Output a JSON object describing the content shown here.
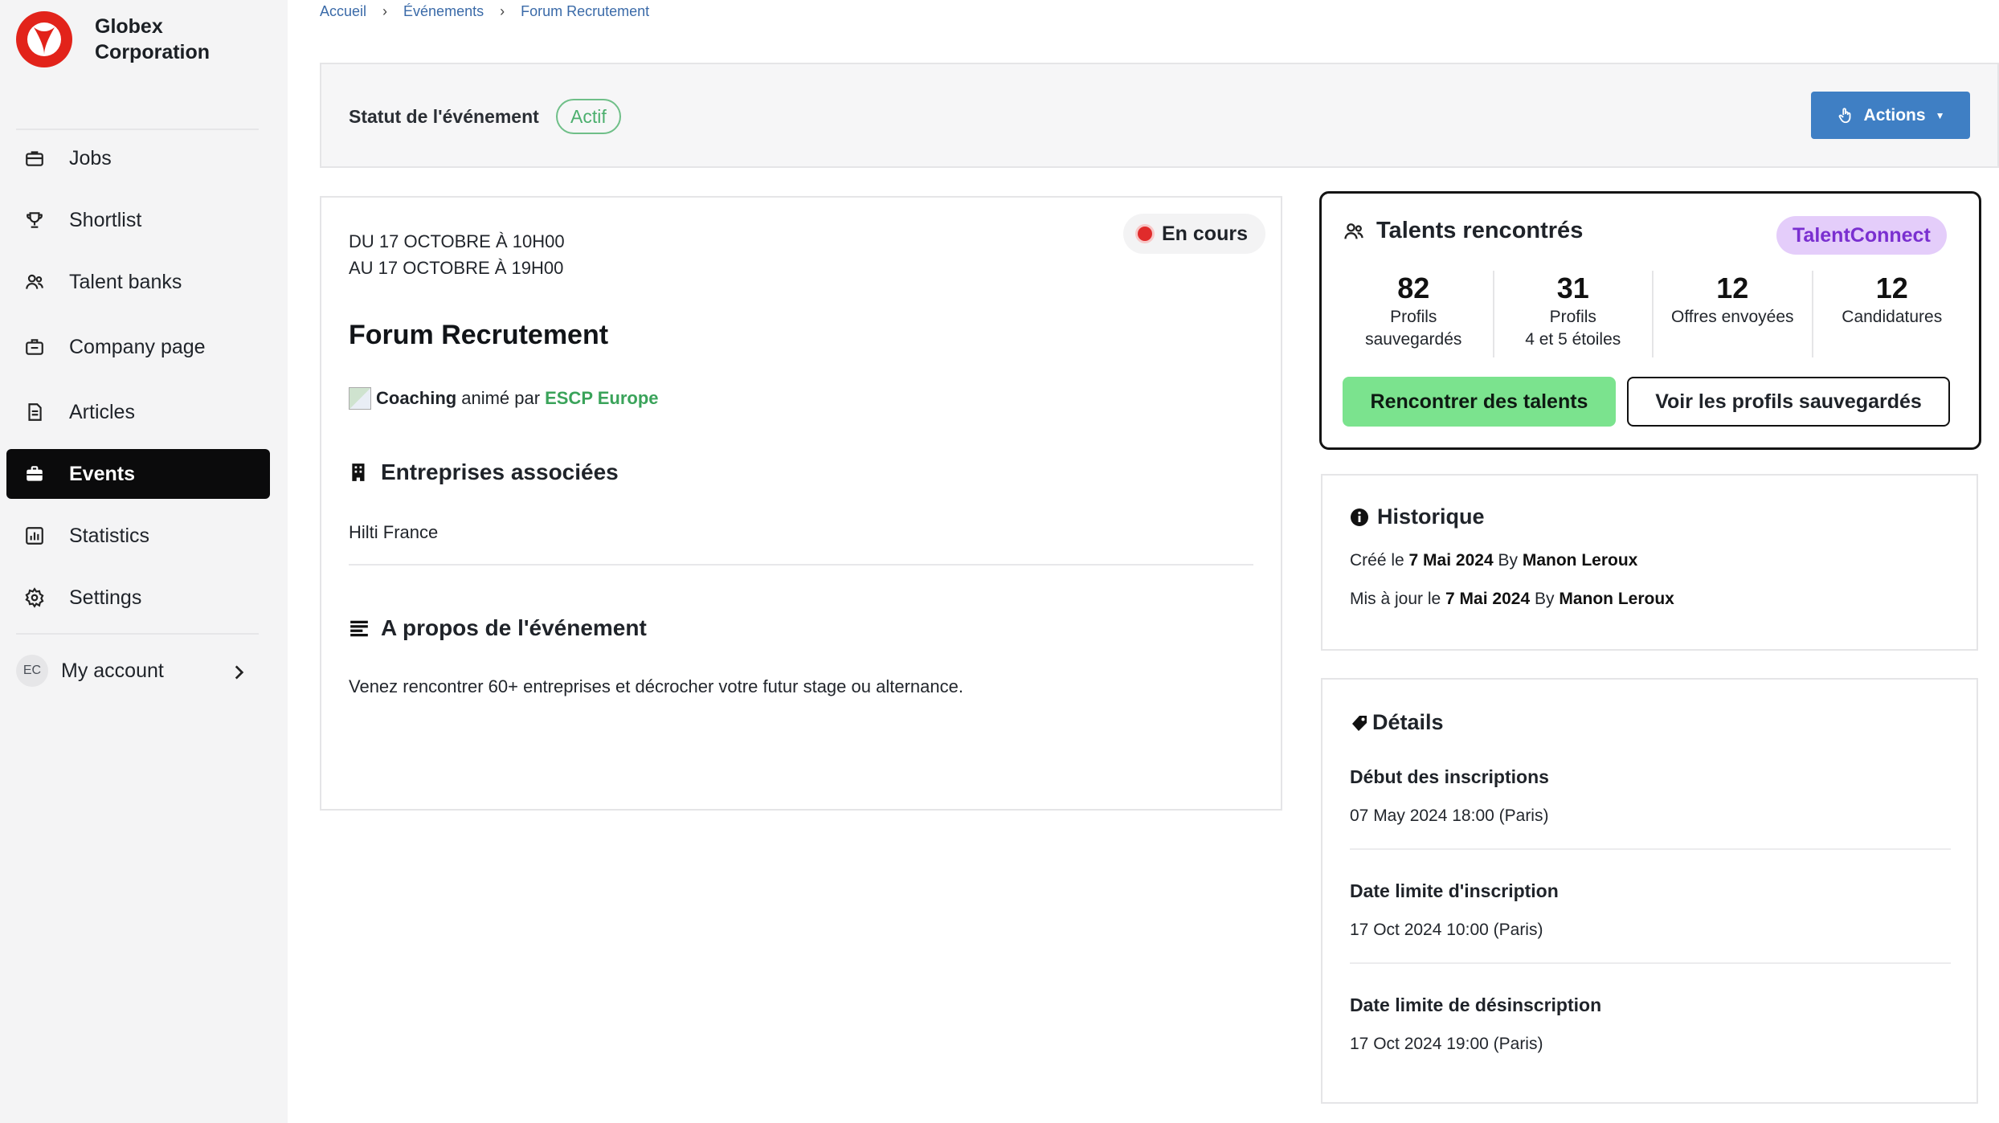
{
  "brand": {
    "name_line1": "Globex",
    "name_line2": "Corporation"
  },
  "nav": {
    "items": [
      {
        "label": "Jobs",
        "icon": "briefcase-icon"
      },
      {
        "label": "Shortlist",
        "icon": "trophy-icon"
      },
      {
        "label": "Talent banks",
        "icon": "users-icon"
      },
      {
        "label": "Company page",
        "icon": "building-briefcase-icon"
      },
      {
        "label": "Articles",
        "icon": "document-icon"
      },
      {
        "label": "Events",
        "icon": "calendar-briefcase-icon",
        "active": true
      },
      {
        "label": "Statistics",
        "icon": "bar-chart-icon"
      },
      {
        "label": "Settings",
        "icon": "gear-icon"
      }
    ],
    "account": {
      "initials": "EC",
      "label": "My account"
    }
  },
  "breadcrumb": [
    "Accueil",
    "Événements",
    "Forum Recrutement"
  ],
  "status": {
    "label": "Statut de l'événement",
    "value": "Actif"
  },
  "actions": {
    "label": "Actions"
  },
  "event": {
    "date_from": "DU 17 OCTOBRE À 10H00",
    "date_to": "AU 17 OCTOBRE À 19H00",
    "live_badge": "En cours",
    "title": "Forum Recrutement",
    "type": "Coaching",
    "hosted_by": "animé par",
    "organizer": "ESCP Europe",
    "companies_heading": "Entreprises associées",
    "company": "Hilti France",
    "about_heading": "A propos de l'événement",
    "about_text": "Venez rencontrer 60+ entreprises et décrocher votre futur stage ou alternance."
  },
  "talents": {
    "title": "Talents rencontrés",
    "badge": "TalentConnect",
    "stats": [
      {
        "value": "82",
        "label": "Profils\nsauvegardés"
      },
      {
        "value": "31",
        "label": "Profils\n4 et 5 étoiles"
      },
      {
        "value": "12",
        "label": "Offres envoyées"
      },
      {
        "value": "12",
        "label": "Candidatures"
      }
    ],
    "primary_button": "Rencontrer des talents",
    "secondary_button": "Voir les profils sauvegardés"
  },
  "history": {
    "title": "Historique",
    "created_prefix": "Créé le",
    "created_date": "7 Mai 2024",
    "by": "By",
    "created_by": "Manon Leroux",
    "updated_prefix": "Mis à jour le",
    "updated_date": "7 Mai 2024",
    "updated_by": "Manon Leroux"
  },
  "details": {
    "title": "Détails",
    "items": [
      {
        "label": "Début des inscriptions",
        "value": "07 May 2024 18:00 (Paris)"
      },
      {
        "label": "Date limite d'inscription",
        "value": "17 Oct 2024 10:00 (Paris)"
      },
      {
        "label": "Date limite de désinscription",
        "value": "17 Oct 2024 19:00 (Paris)"
      }
    ]
  },
  "colors": {
    "accent_blue": "#3f7fc4",
    "active_green": "#4caf6e",
    "cta_green": "#7be38e",
    "talentconnect_purple": "#7a2fd0",
    "live_red": "#e02b2b",
    "logo_red": "#e2231a"
  }
}
